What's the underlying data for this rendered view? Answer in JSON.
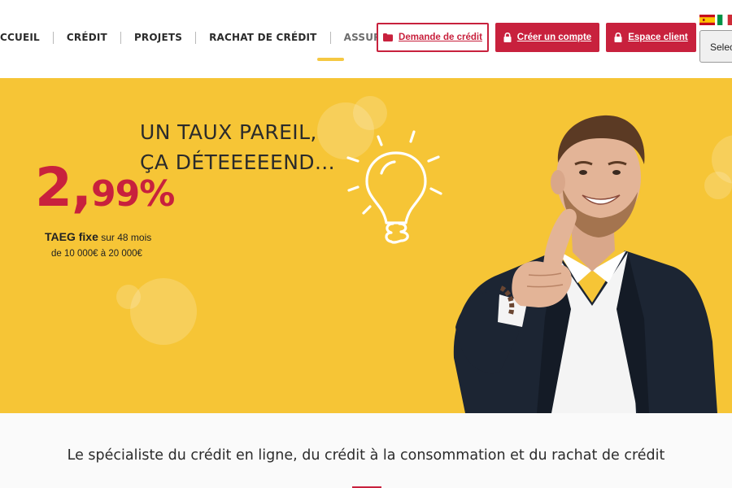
{
  "nav": {
    "items": [
      {
        "label": "CCUEIL"
      },
      {
        "label": "CRÉDIT"
      },
      {
        "label": "PROJETS"
      },
      {
        "label": "RACHAT DE CRÉDIT"
      },
      {
        "label": "ASSURANCE",
        "active": true
      }
    ]
  },
  "buttons": {
    "request_label": "Demande de crédit",
    "create_account_label": "Créer un compte",
    "client_area_label": "Espace client"
  },
  "language": {
    "flags": [
      "spanish-flag",
      "italian-flag"
    ],
    "select_visible_text": "Selec"
  },
  "hero": {
    "slogan_line1": "UN TAUX PAREIL,",
    "slogan_line2": "ÇA DÉTEEEEEND...",
    "rate_main": "2,",
    "rate_decimals": "99%",
    "taeg_bold": "TAEG fixe",
    "taeg_rest": " sur 48 mois",
    "range_text": "de 10 000€ à 20 000€"
  },
  "tagline": "Le spécialiste du crédit en ligne, du crédit à la consommation et du rachat de crédit",
  "colors": {
    "brand_red": "#c8213d",
    "hero_yellow": "#f6c536",
    "text_dark": "#2b2b2b"
  }
}
